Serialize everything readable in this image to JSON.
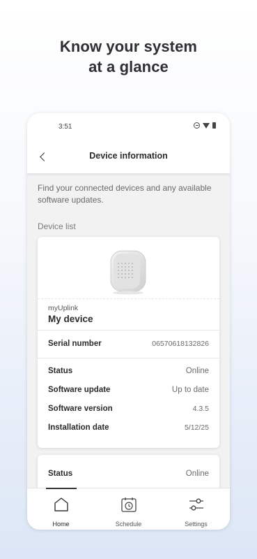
{
  "promo": {
    "headline_line1": "Know your system",
    "headline_line2": "at a glance"
  },
  "statusbar": {
    "time": "3:51"
  },
  "appbar": {
    "title": "Device information"
  },
  "intro_text": "Find your connected devices and any available software updates.",
  "device_list_label": "Device list",
  "device": {
    "brand": "myUplink",
    "name": "My device",
    "serial": {
      "label": "Serial number",
      "value": "06570618132826"
    },
    "status": {
      "label": "Status",
      "value": "Online"
    },
    "software_update": {
      "label": "Software update",
      "value": "Up to date"
    },
    "software_version": {
      "label": "Software version",
      "value": "4.3.5"
    },
    "installation_date": {
      "label": "Installation date",
      "value": "5/12/25"
    }
  },
  "second_card": {
    "status_label": "Status",
    "status_value": "Online"
  },
  "nav": {
    "items": [
      {
        "label": "Home",
        "icon": "home-icon",
        "active": true
      },
      {
        "label": "Schedule",
        "icon": "calendar-clock-icon",
        "active": false
      },
      {
        "label": "Settings",
        "icon": "sliders-icon",
        "active": false
      }
    ]
  },
  "colors": {
    "background_bottom": "#dce6f6",
    "card": "#ffffff",
    "screen": "#f2f2f2",
    "text_primary": "#2b2b2b"
  }
}
